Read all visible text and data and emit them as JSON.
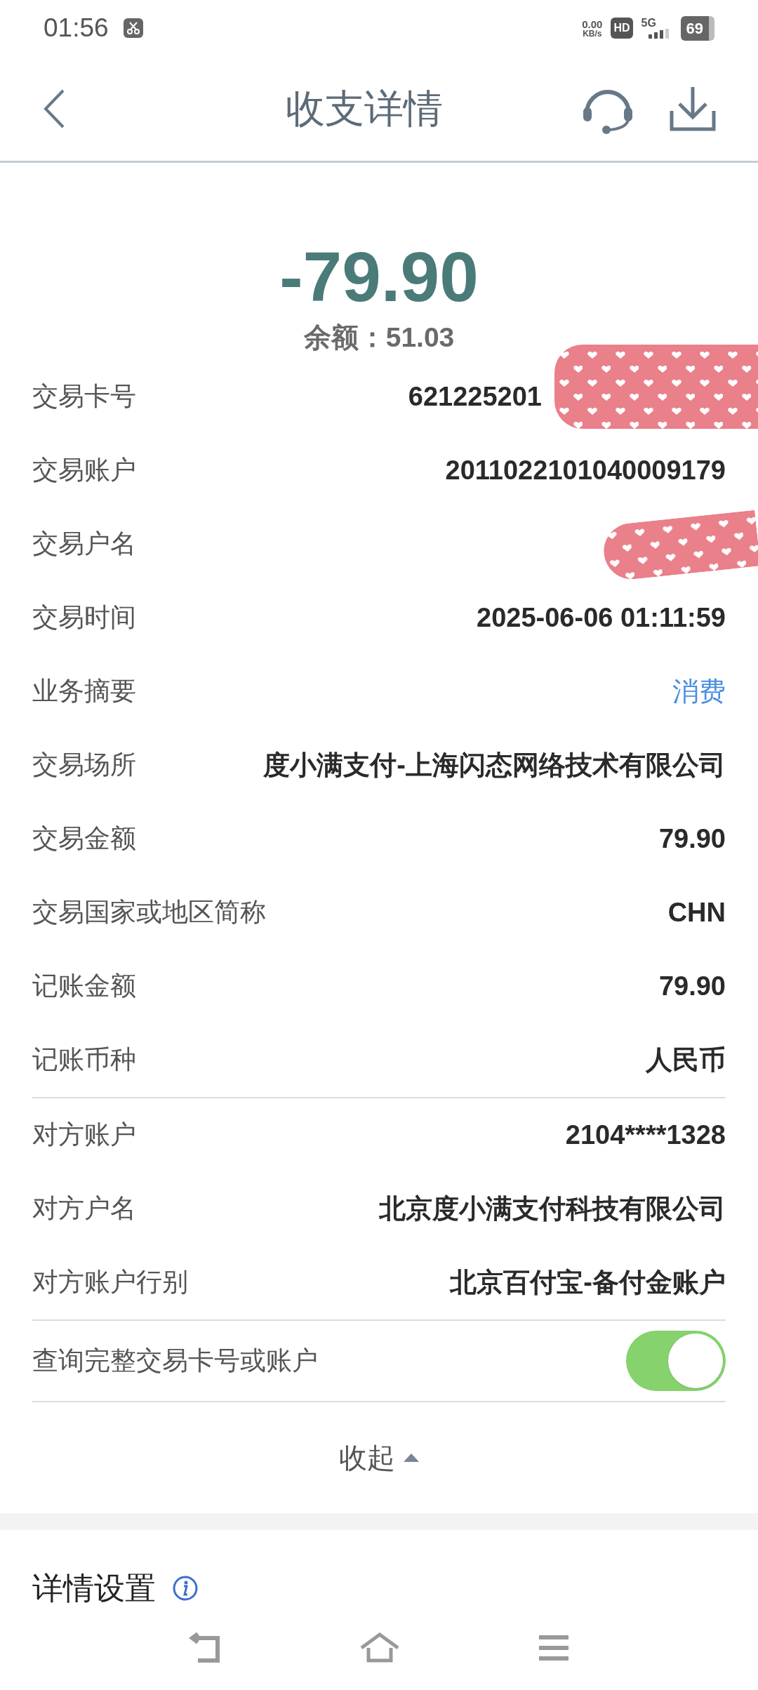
{
  "status_bar": {
    "time": "01:56",
    "net_speed": "0.00",
    "net_unit": "KB/s",
    "hd": "HD",
    "network": "5G",
    "battery": "69"
  },
  "header": {
    "title": "收支详情"
  },
  "summary": {
    "amount": "-79.90",
    "balance": "余额：51.03"
  },
  "details": [
    {
      "label": "交易卡号",
      "value": "621225201",
      "kind": "text",
      "redacted": true
    },
    {
      "label": "交易账户",
      "value": "2011022101040009179",
      "kind": "text",
      "redacted": false
    },
    {
      "label": "交易户名",
      "kind": "text",
      "redacted": true
    },
    {
      "label": "交易时间",
      "value": "2025-06-06 01:11:59",
      "kind": "text",
      "redacted": false
    },
    {
      "label": "业务摘要",
      "value": "消费",
      "kind": "link",
      "redacted": false
    },
    {
      "label": "交易场所",
      "value": "度小满支付-上海闪态网络技术有限公司",
      "kind": "text",
      "redacted": false
    },
    {
      "label": "交易金额",
      "value": "79.90",
      "kind": "text",
      "redacted": false
    },
    {
      "label": "交易国家或地区简称",
      "value": "CHN",
      "kind": "text",
      "redacted": false
    },
    {
      "label": "记账金额",
      "value": "79.90",
      "kind": "text",
      "redacted": false
    },
    {
      "label": "记账币种",
      "value": "人民币",
      "kind": "text",
      "redacted": false
    }
  ],
  "counterparty": [
    {
      "label": "对方账户",
      "value": "2104****1328"
    },
    {
      "label": "对方户名",
      "value": "北京度小满支付科技有限公司"
    },
    {
      "label": "对方账户行别",
      "value": "北京百付宝-备付金账户"
    }
  ],
  "full_number_toggle": {
    "label": "查询完整交易卡号或账户",
    "on": true
  },
  "collapse": {
    "label": "收起",
    "expanded": true
  },
  "settings": {
    "title": "详情设置"
  }
}
